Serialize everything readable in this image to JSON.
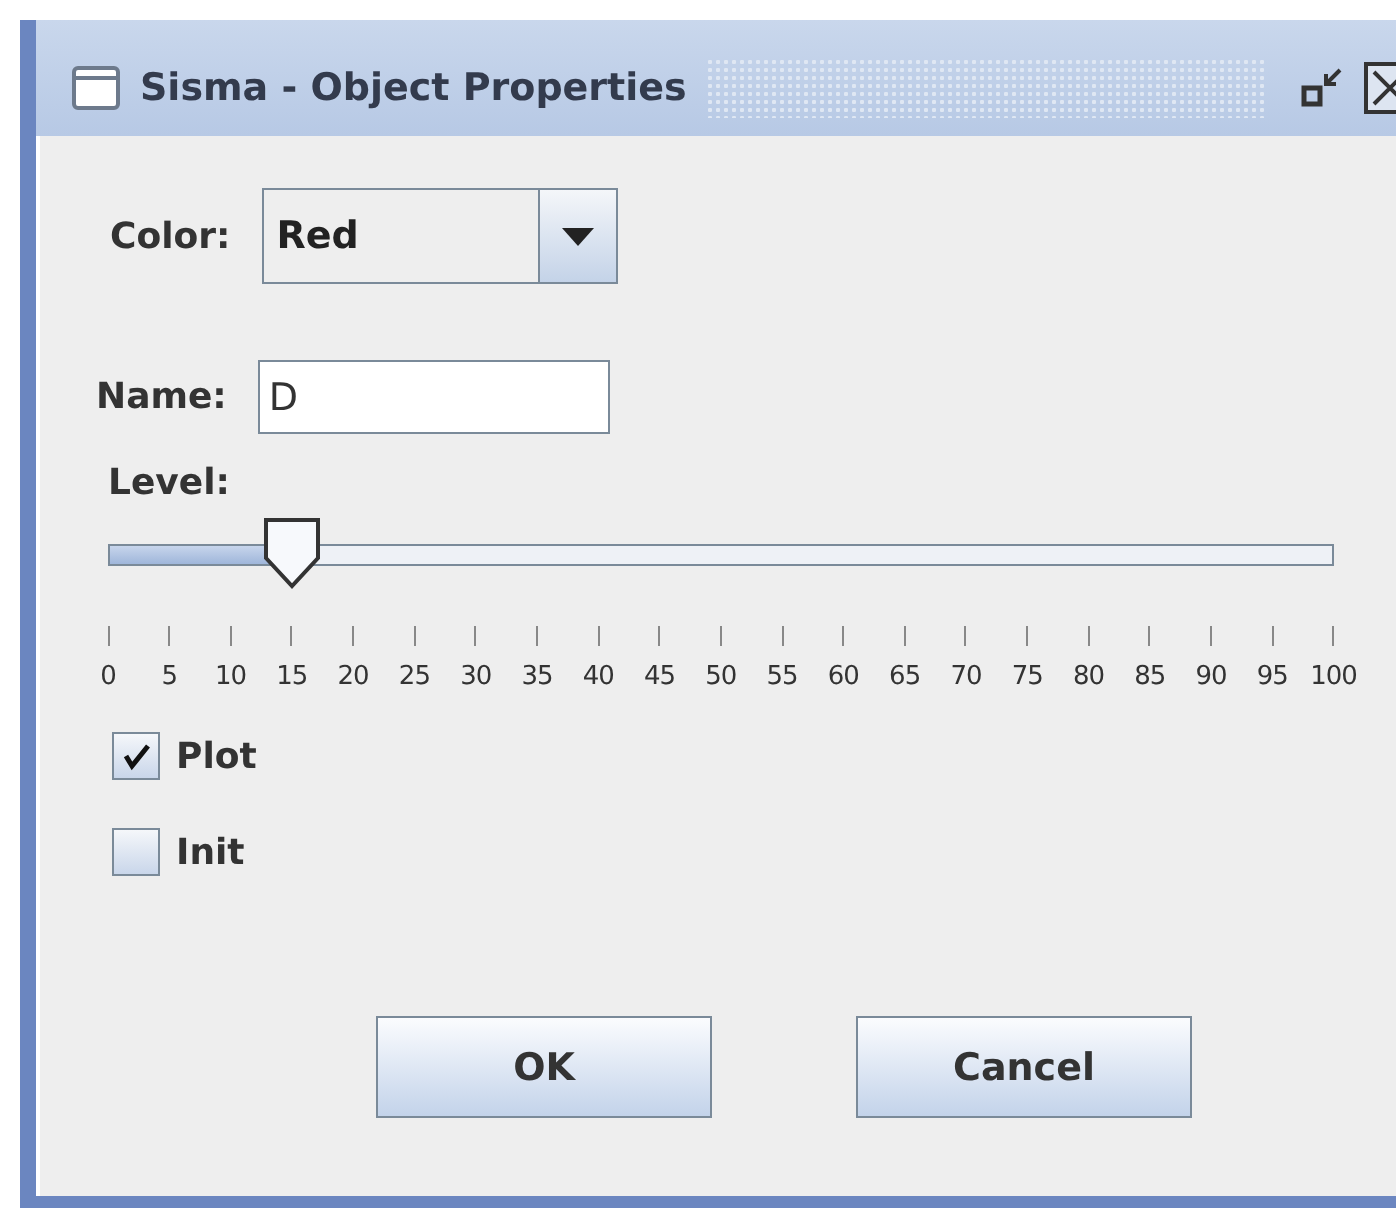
{
  "window": {
    "title": "Sisma - Object Properties"
  },
  "color": {
    "label": "Color:",
    "value": "Red"
  },
  "name": {
    "label": "Name:",
    "value": "D"
  },
  "level": {
    "label": "Level:",
    "level": 0.15,
    "ticks": [
      "0",
      "5",
      "10",
      "15",
      "20",
      "25",
      "30",
      "35",
      "40",
      "45",
      "50",
      "55",
      "60",
      "65",
      "70",
      "75",
      "80",
      "85",
      "90",
      "95",
      "100"
    ]
  },
  "checkboxes": [
    {
      "label": "Plot",
      "checked": true
    },
    {
      "label": "Init",
      "checked": false
    }
  ],
  "buttons": [
    "OK",
    "Cancel"
  ]
}
